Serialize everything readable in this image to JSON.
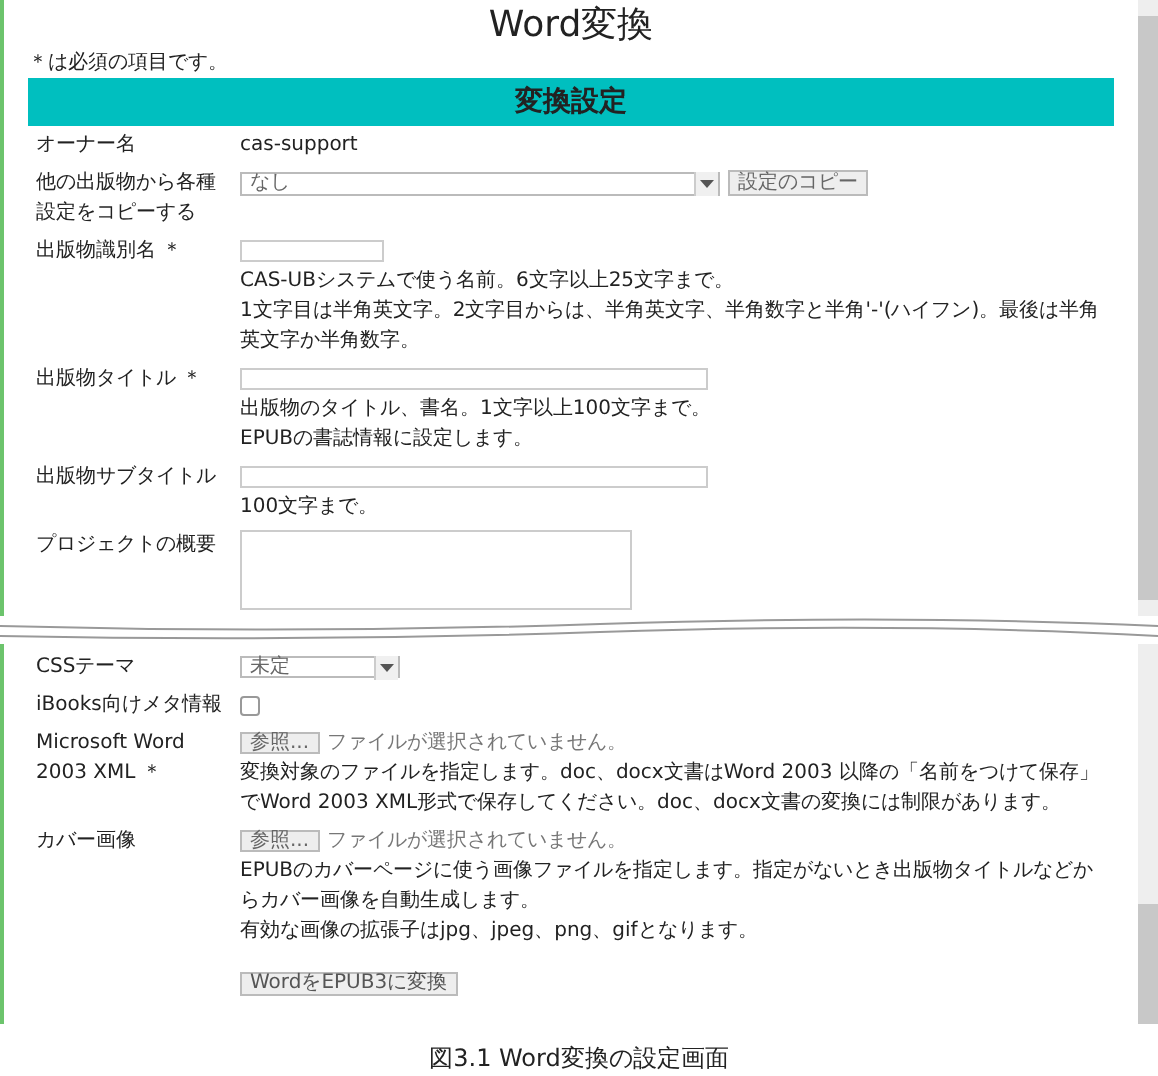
{
  "page_title": "Word変換",
  "required_note": "＊は必須の項目です。",
  "section_title": "変換設定",
  "fields_top": [
    {
      "kind": "text",
      "label": "オーナー名",
      "value": "cas-support"
    },
    {
      "kind": "select_button",
      "label": "他の出版物から各種設定をコピーする",
      "value": "なし",
      "button": "設定のコピー"
    },
    {
      "kind": "short_input",
      "label": "出版物識別名 ＊",
      "help": [
        "CAS-UBシステムで使う名前。6文字以上25文字まで。",
        "1文字目は半角英文字。2文字目からは、半角英文字、半角数字と半角'-'(ハイフン)。最後は半角英文字か半角数字。"
      ]
    },
    {
      "kind": "long_input",
      "label": "出版物タイトル ＊",
      "help": [
        "出版物のタイトル、書名。1文字以上100文字まで。",
        "EPUBの書誌情報に設定します。"
      ]
    },
    {
      "kind": "long_input",
      "label": "出版物サブタイトル",
      "help": [
        "100文字まで。"
      ]
    },
    {
      "kind": "textarea",
      "label": "プロジェクトの概要"
    }
  ],
  "fields_bottom": [
    {
      "kind": "select",
      "label": "CSSテーマ",
      "value": "未定"
    },
    {
      "kind": "checkbox",
      "label": "iBooks向けメタ情報",
      "checked": false
    },
    {
      "kind": "file",
      "label": "Microsoft Word 2003 XML ＊",
      "button": "参照...",
      "status": "ファイルが選択されていません。",
      "help": [
        "変換対象のファイルを指定します。doc、docx文書はWord 2003 以降の「名前をつけて保存」でWord 2003 XML形式で保存してください。doc、docx文書の変換には制限があります。"
      ]
    },
    {
      "kind": "file",
      "label": "カバー画像",
      "button": "参照...",
      "status": "ファイルが選択されていません。",
      "help": [
        "EPUBのカバーページに使う画像ファイルを指定します。指定がないとき出版物タイトルなどからカバー画像を自動生成します。",
        "有効な画像の拡張子はjpg、jpeg、png、gifとなります。"
      ]
    }
  ],
  "submit_button": "WordをEPUB3に変換",
  "caption": "図3.1 Word変換の設定画面"
}
